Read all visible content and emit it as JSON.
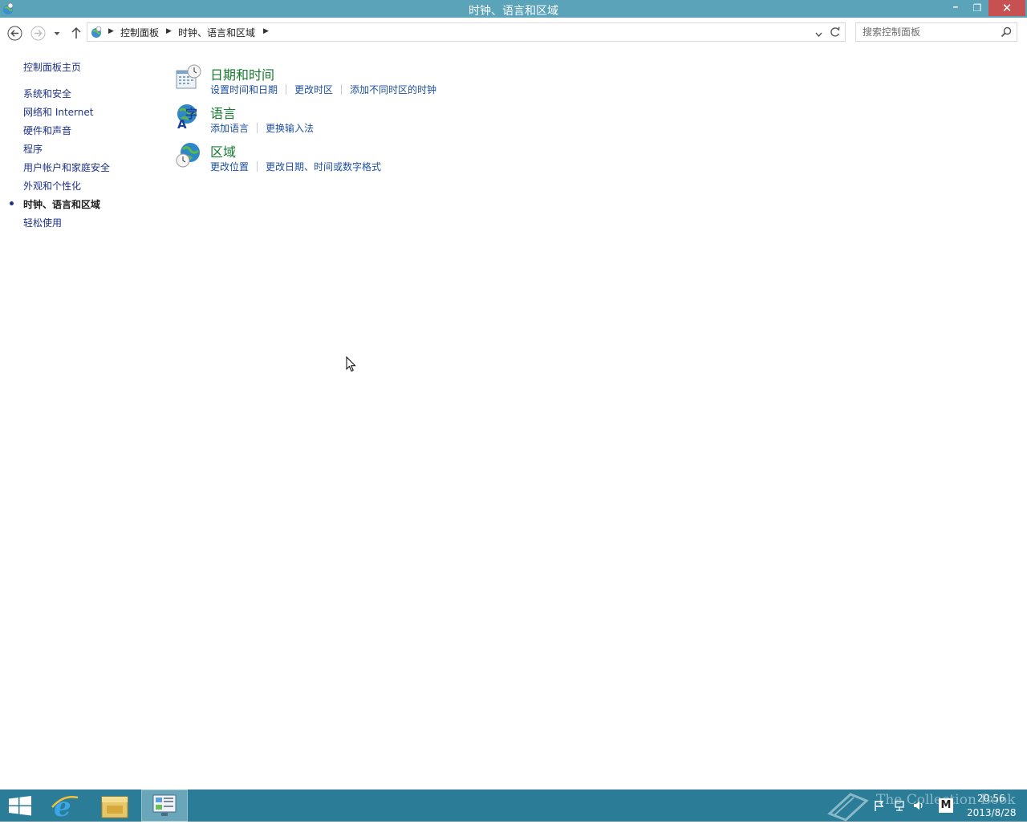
{
  "window": {
    "title": "时钟、语言和区域",
    "minimize_glyph": "━",
    "maximize_glyph": "❐",
    "close_glyph": "✕"
  },
  "address": {
    "crumbs": [
      "控制面板",
      "时钟、语言和区域"
    ],
    "search_placeholder": "搜索控制面板"
  },
  "sidebar": {
    "home": "控制面板主页",
    "items": [
      {
        "label": "系统和安全"
      },
      {
        "label": "网络和 Internet"
      },
      {
        "label": "硬件和声音"
      },
      {
        "label": "程序"
      },
      {
        "label": "用户帐户和家庭安全"
      },
      {
        "label": "外观和个性化"
      },
      {
        "label": "时钟、语言和区域",
        "current": true
      },
      {
        "label": "轻松使用"
      }
    ]
  },
  "categories": [
    {
      "title": "日期和时间",
      "icon": "calendar-clock-icon",
      "links": [
        "设置时间和日期",
        "更改时区",
        "添加不同时区的时钟"
      ]
    },
    {
      "title": "语言",
      "icon": "language-globe-icon",
      "links": [
        "添加语言",
        "更换输入法"
      ]
    },
    {
      "title": "区域",
      "icon": "region-globe-clock-icon",
      "links": [
        "更改位置",
        "更改日期、时间或数字格式"
      ]
    }
  ],
  "taskbar": {
    "watermark": "The Collection Book",
    "time": "20:56",
    "date": "2013/8/28",
    "ime_label": "M",
    "accent": "#2a7c97"
  }
}
